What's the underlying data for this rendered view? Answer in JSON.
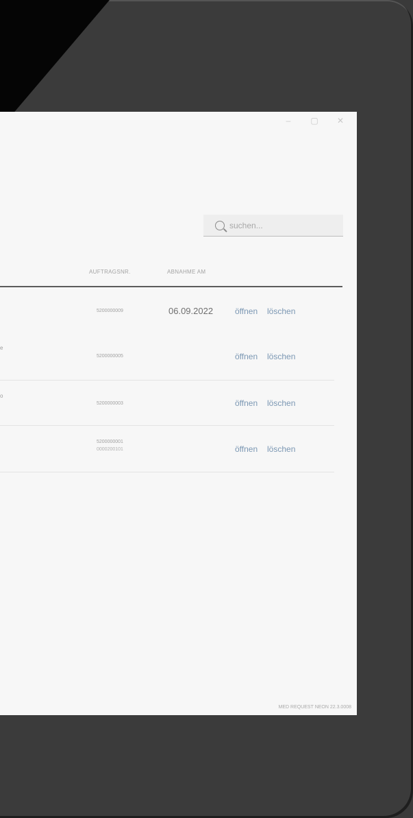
{
  "window": {
    "controls": [
      "–",
      "▢",
      "✕"
    ]
  },
  "search": {
    "placeholder": "suchen..."
  },
  "table": {
    "headers": {
      "order_no": "AUFTRAGSNR.",
      "accept_date": "ABNAHME AM"
    },
    "rows": [
      {
        "order_no": "5200000009",
        "order_no_2": "",
        "date": "06.09.2022",
        "open": "öffnen",
        "delete": "löschen",
        "left_fragment": ""
      },
      {
        "order_no": "5200000005",
        "order_no_2": "",
        "date": "",
        "open": "öffnen",
        "delete": "löschen",
        "left_fragment": "e"
      },
      {
        "order_no": "5200000003",
        "order_no_2": "",
        "date": "",
        "open": "öffnen",
        "delete": "löschen",
        "left_fragment": "o"
      },
      {
        "order_no": "5200000001",
        "order_no_2": "0000200101",
        "date": "",
        "open": "öffnen",
        "delete": "löschen",
        "left_fragment": ""
      }
    ]
  },
  "footer": {
    "version": "MED REQUEST NEON 22.3.0008"
  }
}
